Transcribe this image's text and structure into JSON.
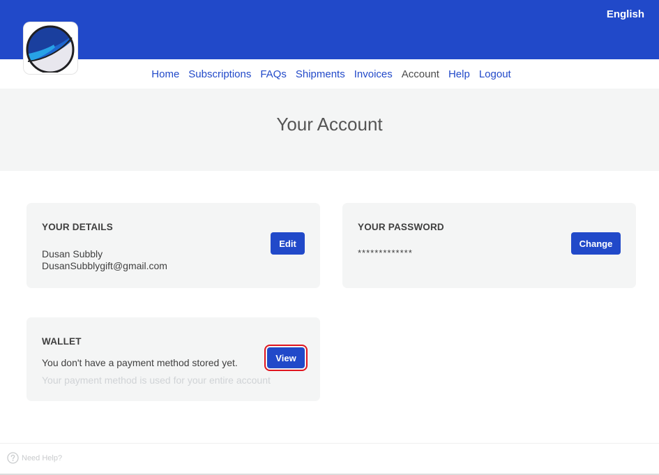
{
  "header": {
    "language": "English",
    "brand_color": "#2149c9"
  },
  "nav": {
    "items": [
      {
        "label": "Home"
      },
      {
        "label": "Subscriptions"
      },
      {
        "label": "FAQs"
      },
      {
        "label": "Shipments"
      },
      {
        "label": "Invoices"
      },
      {
        "label": "Account",
        "active": true
      },
      {
        "label": "Help"
      },
      {
        "label": "Logout"
      }
    ]
  },
  "page": {
    "title": "Your Account"
  },
  "details": {
    "heading": "YOUR DETAILS",
    "name": "Dusan Subbly",
    "email": "DusanSubblygift@gmail.com",
    "button_label": "Edit"
  },
  "password": {
    "heading": "YOUR PASSWORD",
    "masked_value": "*************",
    "button_label": "Change"
  },
  "wallet": {
    "heading": "WALLET",
    "message": "You don't have a payment method stored yet.",
    "note": "Your payment method is used for your entire account",
    "button_label": "View"
  },
  "footer": {
    "help_label": "Need Help?",
    "help_icon": "question-circle-icon"
  }
}
